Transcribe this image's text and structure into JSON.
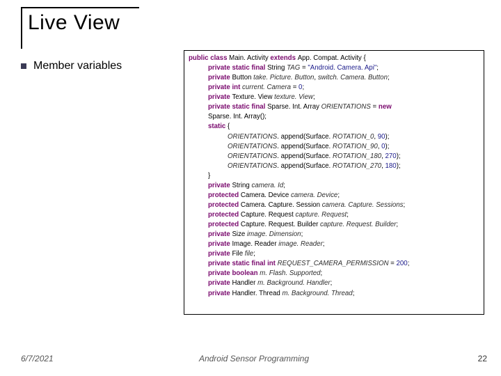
{
  "title": "Live View",
  "bullet": "Member variables",
  "footer": {
    "date": "6/7/2021",
    "center": "Android Sensor Programming",
    "page": "22"
  },
  "code": {
    "l0": {
      "a": "public class ",
      "b": "Main. Activity ",
      "c": "extends ",
      "d": "App. Compat. Activity {"
    },
    "l1": {
      "a": "private static final ",
      "b": "String ",
      "c": "TAG ",
      "d": "= ",
      "e": "\"Android. Camera. Api\"",
      "f": ";"
    },
    "l2": {
      "a": "private ",
      "b": "Button ",
      "c": "take. Picture. Button",
      "d": ", ",
      "e": "switch. Camera. Button",
      "f": ";"
    },
    "l3": {
      "a": "private int ",
      "b": "current. Camera ",
      "c": "= ",
      "d": "0",
      "e": ";"
    },
    "l4": {
      "a": "private ",
      "b": "Texture. View ",
      "c": "texture. View",
      "d": ";"
    },
    "l5": {
      "a": "private static final ",
      "b": "Sparse. Int. Array ",
      "c": "ORIENTATIONS ",
      "d": "= ",
      "e": "new"
    },
    "l6": {
      "a": "Sparse. Int. Array();"
    },
    "l7": {
      "a": "static ",
      "b": "{"
    },
    "l8": {
      "a": "ORIENTATIONS",
      "b": ". append(Surface. ",
      "c": "ROTATION_0",
      "d": ", ",
      "e": "90",
      "f": ");"
    },
    "l9": {
      "a": "ORIENTATIONS",
      "b": ". append(Surface. ",
      "c": "ROTATION_90",
      "d": ", ",
      "e": "0",
      "f": ");"
    },
    "l10": {
      "a": "ORIENTATIONS",
      "b": ". append(Surface. ",
      "c": "ROTATION_180",
      "d": ", ",
      "e": "270",
      "f": ");"
    },
    "l11": {
      "a": "ORIENTATIONS",
      "b": ". append(Surface. ",
      "c": "ROTATION_270",
      "d": ", ",
      "e": "180",
      "f": ");"
    },
    "l12": {
      "a": "}"
    },
    "l13": {
      "a": "private ",
      "b": "String ",
      "c": "camera. Id",
      "d": ";"
    },
    "l14": {
      "a": "protected ",
      "b": "Camera. Device ",
      "c": "camera. Device",
      "d": ";"
    },
    "l15": {
      "a": "protected ",
      "b": "Camera. Capture. Session ",
      "c": "camera. Capture. Sessions",
      "d": ";"
    },
    "l16": {
      "a": "protected ",
      "b": "Capture. Request ",
      "c": "capture. Request",
      "d": ";"
    },
    "l17": {
      "a": "protected ",
      "b": "Capture. Request. Builder ",
      "c": "capture. Request. Builder",
      "d": ";"
    },
    "l18": {
      "a": "private ",
      "b": "Size ",
      "c": "image. Dimension",
      "d": ";"
    },
    "l19": {
      "a": "private ",
      "b": "Image. Reader ",
      "c": "image. Reader",
      "d": ";"
    },
    "l20": {
      "a": "private ",
      "b": "File ",
      "c": "file",
      "d": ";"
    },
    "l21": {
      "a": "private static final int ",
      "b": "REQUEST_CAMERA_PERMISSION ",
      "c": "= ",
      "d": "200",
      "e": ";"
    },
    "l22": {
      "a": "private boolean ",
      "b": "m. Flash. Supported",
      "c": ";"
    },
    "l23": {
      "a": "private ",
      "b": "Handler ",
      "c": "m. Background. Handler",
      "d": ";"
    },
    "l24": {
      "a": "private ",
      "b": "Handler. Thread ",
      "c": "m. Background. Thread",
      "d": ";"
    }
  }
}
